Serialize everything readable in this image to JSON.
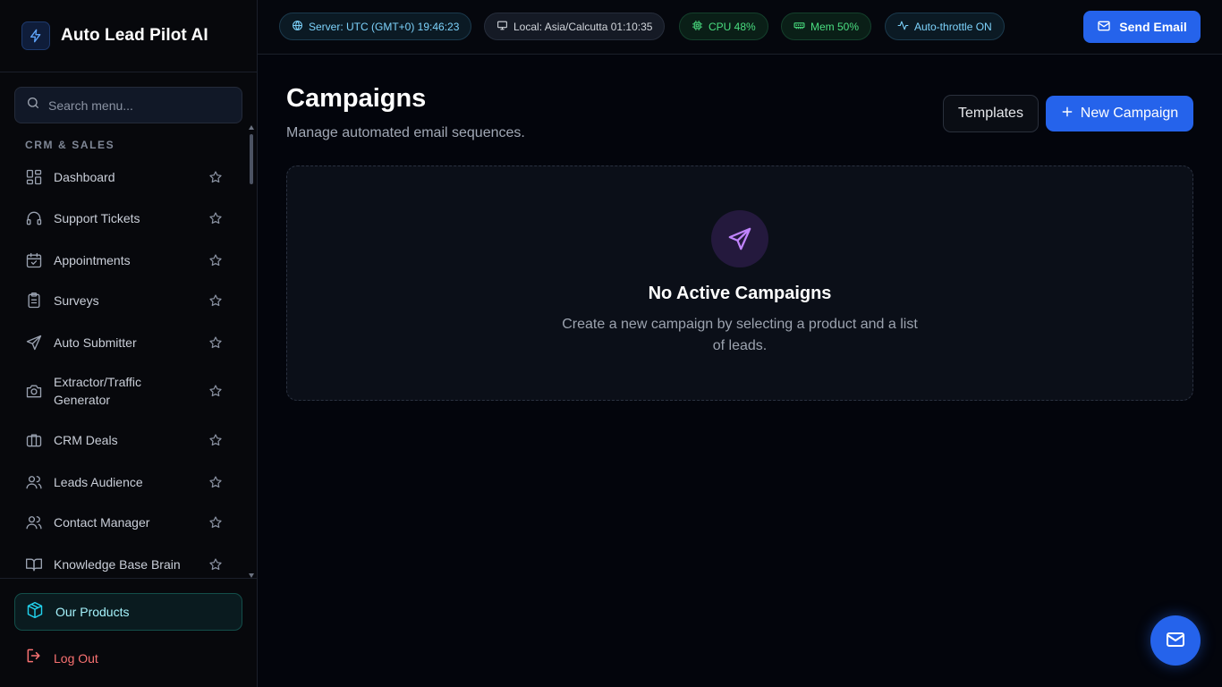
{
  "app": {
    "title": "Auto Lead Pilot AI"
  },
  "sidebar": {
    "search_placeholder": "Search menu...",
    "section_label": "CRM & SALES",
    "items": [
      {
        "label": "Dashboard",
        "icon": "dashboard-icon"
      },
      {
        "label": "Support Tickets",
        "icon": "headset-icon"
      },
      {
        "label": "Appointments",
        "icon": "calendar-check-icon"
      },
      {
        "label": "Surveys",
        "icon": "clipboard-list-icon"
      },
      {
        "label": "Auto Submitter",
        "icon": "send-icon"
      },
      {
        "label": "Extractor/Traffic Generator",
        "icon": "camera-icon"
      },
      {
        "label": "CRM Deals",
        "icon": "briefcase-icon"
      },
      {
        "label": "Leads Audience",
        "icon": "users-icon"
      },
      {
        "label": "Contact Manager",
        "icon": "users-icon"
      },
      {
        "label": "Knowledge Base Brain",
        "icon": "book-open-icon"
      }
    ],
    "footer": {
      "products_label": "Our Products",
      "logout_label": "Log Out"
    }
  },
  "topbar": {
    "server": "Server: UTC (GMT+0) 19:46:23",
    "local": "Local: Asia/Calcutta 01:10:35",
    "cpu": "CPU 48%",
    "mem": "Mem 50%",
    "throttle": "Auto-throttle ON",
    "send_email_label": "Send Email"
  },
  "main": {
    "title": "Campaigns",
    "subtitle": "Manage automated email sequences.",
    "templates_label": "Templates",
    "new_campaign_label": "New Campaign",
    "empty_state": {
      "title": "No Active Campaigns",
      "description": "Create a new campaign by selecting a product and a list of leads."
    }
  },
  "colors": {
    "accent": "#2563eb",
    "background": "#03050c",
    "sidebar": "#07080c",
    "cyan": "#22d3ee",
    "green": "#4ade80",
    "danger": "#f87171",
    "purple": "#c084fc"
  }
}
